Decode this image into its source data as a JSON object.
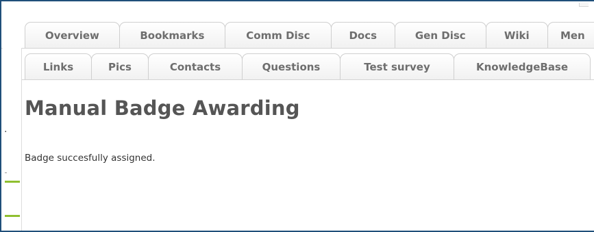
{
  "tabs": {
    "row1": [
      "Overview",
      "Bookmarks",
      "Comm Disc",
      "Docs",
      "Gen Disc",
      "Wiki",
      "Men"
    ],
    "row2": [
      "Links",
      "Pics",
      "Contacts",
      "Questions",
      "Test survey",
      "KnowledgeBase"
    ]
  },
  "main": {
    "title": "Manual Badge Awarding",
    "message": "Badge succesfully assigned."
  },
  "gutter": {
    "dot": "."
  },
  "colors": {
    "frame_border": "#1f4f7a",
    "accent_green": "#8fbf2f",
    "tab_text": "#6e6e6e",
    "title_text": "#555555"
  }
}
